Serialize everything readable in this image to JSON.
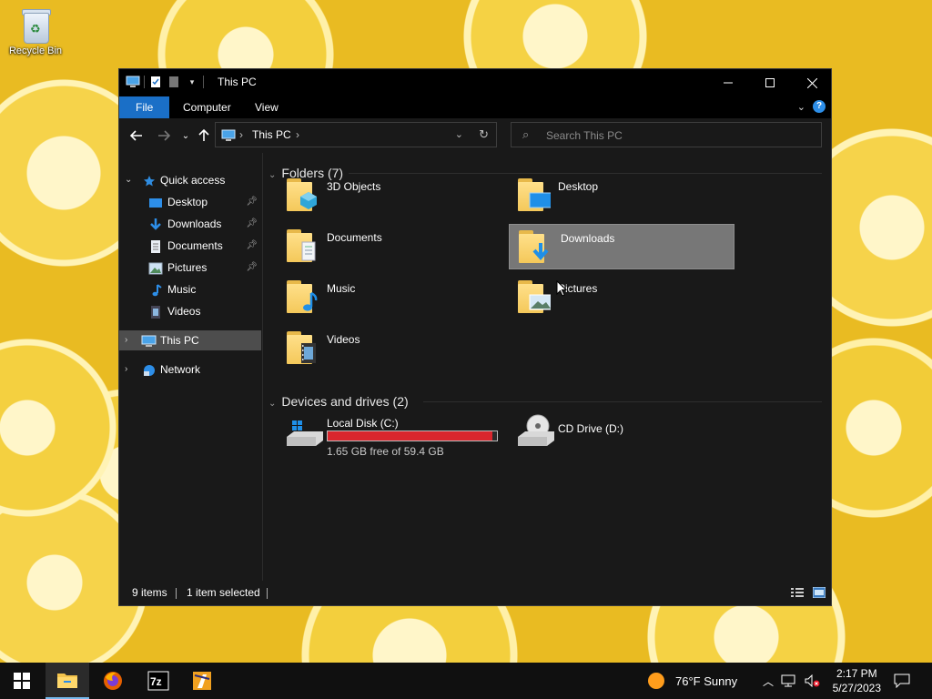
{
  "desktop": {
    "recycle_bin_label": "Recycle Bin"
  },
  "window": {
    "title": "This PC",
    "ribbon_tabs": [
      "File",
      "Computer",
      "View"
    ],
    "address": {
      "crumb": "This PC"
    },
    "search": {
      "placeholder": "Search This PC"
    }
  },
  "sidebar": {
    "quick_access": "Quick access",
    "items": [
      {
        "label": "Desktop",
        "icon": "desktop-icon",
        "pinned": true
      },
      {
        "label": "Downloads",
        "icon": "download-arrow-icon",
        "pinned": true
      },
      {
        "label": "Documents",
        "icon": "document-icon",
        "pinned": true
      },
      {
        "label": "Pictures",
        "icon": "picture-icon",
        "pinned": true
      },
      {
        "label": "Music",
        "icon": "music-note-icon",
        "pinned": false
      },
      {
        "label": "Videos",
        "icon": "film-icon",
        "pinned": false
      }
    ],
    "this_pc": "This PC",
    "network": "Network"
  },
  "content": {
    "folders_header": "Folders (7)",
    "folders": [
      {
        "name": "3D Objects",
        "icon": "cube-icon"
      },
      {
        "name": "Desktop",
        "icon": "desktop-icon"
      },
      {
        "name": "Documents",
        "icon": "document-icon"
      },
      {
        "name": "Downloads",
        "icon": "download-arrow-icon",
        "selected": true
      },
      {
        "name": "Music",
        "icon": "music-note-icon"
      },
      {
        "name": "Pictures",
        "icon": "picture-icon"
      },
      {
        "name": "Videos",
        "icon": "film-icon"
      }
    ],
    "devices_header": "Devices and drives (2)",
    "drives": [
      {
        "name": "Local Disk (C:)",
        "free_text": "1.65 GB free of 59.4 GB",
        "used_fraction": 0.972,
        "bar_color": "#d9262d"
      },
      {
        "name": "CD Drive (D:)"
      }
    ]
  },
  "status": {
    "items": "9 items",
    "selected": "1 item selected"
  },
  "taskbar": {
    "apps": [
      "start-icon",
      "file-explorer-icon",
      "firefox-icon",
      "7zip-icon",
      "app-icon"
    ],
    "weather": "76°F  Sunny",
    "time": "2:17 PM",
    "date": "5/27/2023"
  },
  "colors": {
    "accent": "#1a6fc7",
    "window_bg": "#191919",
    "selection": "#777777"
  }
}
